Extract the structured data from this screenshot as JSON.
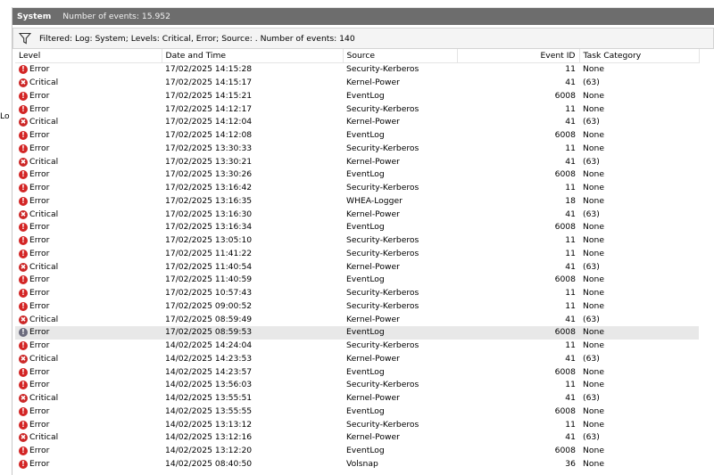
{
  "left_pane": {
    "text": "Lo"
  },
  "header": {
    "title": "System",
    "count": "Number of events: 15.952"
  },
  "filter": {
    "text": "Filtered: Log: System; Levels: Critical, Error; Source: . Number of events: 140"
  },
  "columns": {
    "level": "Level",
    "datetime": "Date and Time",
    "source": "Source",
    "event_id": "Event ID",
    "task_category": "Task Category"
  },
  "colors": {
    "header_bg": "#6d6d6d",
    "error_icon": "#d32525",
    "selected_row": "#e8e8e8"
  },
  "selected_row_index": 20,
  "events": [
    {
      "level": "Error",
      "datetime": "17/02/2025 14:15:28",
      "source": "Security-Kerberos",
      "event_id": "11",
      "task_category": "None"
    },
    {
      "level": "Critical",
      "datetime": "17/02/2025 14:15:17",
      "source": "Kernel-Power",
      "event_id": "41",
      "task_category": "(63)"
    },
    {
      "level": "Error",
      "datetime": "17/02/2025 14:15:21",
      "source": "EventLog",
      "event_id": "6008",
      "task_category": "None"
    },
    {
      "level": "Error",
      "datetime": "17/02/2025 14:12:17",
      "source": "Security-Kerberos",
      "event_id": "11",
      "task_category": "None"
    },
    {
      "level": "Critical",
      "datetime": "17/02/2025 14:12:04",
      "source": "Kernel-Power",
      "event_id": "41",
      "task_category": "(63)"
    },
    {
      "level": "Error",
      "datetime": "17/02/2025 14:12:08",
      "source": "EventLog",
      "event_id": "6008",
      "task_category": "None"
    },
    {
      "level": "Error",
      "datetime": "17/02/2025 13:30:33",
      "source": "Security-Kerberos",
      "event_id": "11",
      "task_category": "None"
    },
    {
      "level": "Critical",
      "datetime": "17/02/2025 13:30:21",
      "source": "Kernel-Power",
      "event_id": "41",
      "task_category": "(63)"
    },
    {
      "level": "Error",
      "datetime": "17/02/2025 13:30:26",
      "source": "EventLog",
      "event_id": "6008",
      "task_category": "None"
    },
    {
      "level": "Error",
      "datetime": "17/02/2025 13:16:42",
      "source": "Security-Kerberos",
      "event_id": "11",
      "task_category": "None"
    },
    {
      "level": "Error",
      "datetime": "17/02/2025 13:16:35",
      "source": "WHEA-Logger",
      "event_id": "18",
      "task_category": "None"
    },
    {
      "level": "Critical",
      "datetime": "17/02/2025 13:16:30",
      "source": "Kernel-Power",
      "event_id": "41",
      "task_category": "(63)"
    },
    {
      "level": "Error",
      "datetime": "17/02/2025 13:16:34",
      "source": "EventLog",
      "event_id": "6008",
      "task_category": "None"
    },
    {
      "level": "Error",
      "datetime": "17/02/2025 13:05:10",
      "source": "Security-Kerberos",
      "event_id": "11",
      "task_category": "None"
    },
    {
      "level": "Error",
      "datetime": "17/02/2025 11:41:22",
      "source": "Security-Kerberos",
      "event_id": "11",
      "task_category": "None"
    },
    {
      "level": "Critical",
      "datetime": "17/02/2025 11:40:54",
      "source": "Kernel-Power",
      "event_id": "41",
      "task_category": "(63)"
    },
    {
      "level": "Error",
      "datetime": "17/02/2025 11:40:59",
      "source": "EventLog",
      "event_id": "6008",
      "task_category": "None"
    },
    {
      "level": "Error",
      "datetime": "17/02/2025 10:57:43",
      "source": "Security-Kerberos",
      "event_id": "11",
      "task_category": "None"
    },
    {
      "level": "Error",
      "datetime": "17/02/2025 09:00:52",
      "source": "Security-Kerberos",
      "event_id": "11",
      "task_category": "None"
    },
    {
      "level": "Critical",
      "datetime": "17/02/2025 08:59:49",
      "source": "Kernel-Power",
      "event_id": "41",
      "task_category": "(63)"
    },
    {
      "level": "Error",
      "datetime": "17/02/2025 08:59:53",
      "source": "EventLog",
      "event_id": "6008",
      "task_category": "None"
    },
    {
      "level": "Error",
      "datetime": "14/02/2025 14:24:04",
      "source": "Security-Kerberos",
      "event_id": "11",
      "task_category": "None"
    },
    {
      "level": "Critical",
      "datetime": "14/02/2025 14:23:53",
      "source": "Kernel-Power",
      "event_id": "41",
      "task_category": "(63)"
    },
    {
      "level": "Error",
      "datetime": "14/02/2025 14:23:57",
      "source": "EventLog",
      "event_id": "6008",
      "task_category": "None"
    },
    {
      "level": "Error",
      "datetime": "14/02/2025 13:56:03",
      "source": "Security-Kerberos",
      "event_id": "11",
      "task_category": "None"
    },
    {
      "level": "Critical",
      "datetime": "14/02/2025 13:55:51",
      "source": "Kernel-Power",
      "event_id": "41",
      "task_category": "(63)"
    },
    {
      "level": "Error",
      "datetime": "14/02/2025 13:55:55",
      "source": "EventLog",
      "event_id": "6008",
      "task_category": "None"
    },
    {
      "level": "Error",
      "datetime": "14/02/2025 13:13:12",
      "source": "Security-Kerberos",
      "event_id": "11",
      "task_category": "None"
    },
    {
      "level": "Critical",
      "datetime": "14/02/2025 13:12:16",
      "source": "Kernel-Power",
      "event_id": "41",
      "task_category": "(63)"
    },
    {
      "level": "Error",
      "datetime": "14/02/2025 13:12:20",
      "source": "EventLog",
      "event_id": "6008",
      "task_category": "None"
    },
    {
      "level": "Error",
      "datetime": "14/02/2025 08:40:50",
      "source": "Volsnap",
      "event_id": "36",
      "task_category": "None"
    }
  ]
}
